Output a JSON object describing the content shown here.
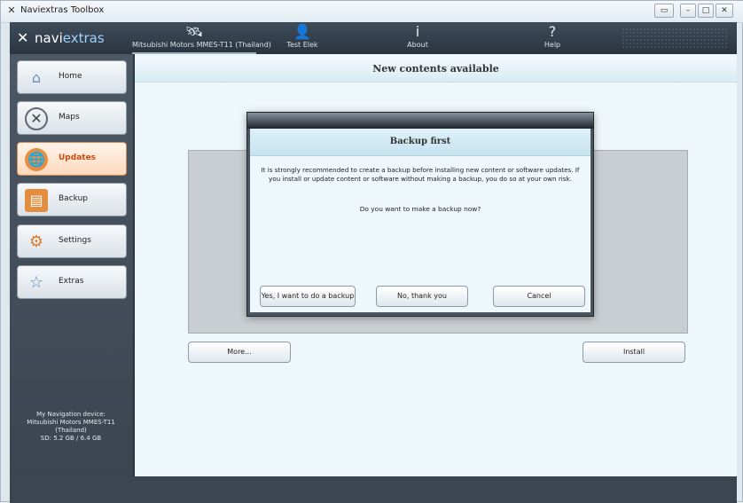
{
  "window": {
    "title": "Naviextras Toolbox",
    "app_icon": "naviextras-x-icon",
    "controls": [
      "window-extra-icon",
      "minimize-icon",
      "maximize-icon",
      "close-icon"
    ]
  },
  "brand": {
    "word1": "navi",
    "word2": "extras"
  },
  "topnav": {
    "tabs": [
      {
        "label": "Mitsubishi Motors MMES-T11 (Thailand)",
        "icon": "satellite-icon",
        "active": true
      },
      {
        "label": "Test Elek",
        "icon": "user-icon",
        "active": false
      },
      {
        "label": "About",
        "icon": "info-icon",
        "active": false
      },
      {
        "label": "Help",
        "icon": "question-icon",
        "active": false
      }
    ]
  },
  "sidebar": {
    "items": [
      {
        "label": "Home",
        "icon": "home-icon",
        "active": false
      },
      {
        "label": "Maps",
        "icon": "maps-icon",
        "active": false
      },
      {
        "label": "Updates",
        "icon": "updates-icon",
        "active": true
      },
      {
        "label": "Backup",
        "icon": "backup-icon",
        "active": false
      },
      {
        "label": "Settings",
        "icon": "settings-icon",
        "active": false
      },
      {
        "label": "Extras",
        "icon": "star-icon",
        "active": false
      }
    ],
    "device_info": [
      "My Navigation device:",
      "Mitsubishi Motors MMES-T11",
      "(Thailand)",
      "SD: 5.2 GB / 6.4 GB"
    ]
  },
  "main": {
    "title": "New contents available",
    "more_button": "More...",
    "install_button": "Install"
  },
  "dialog": {
    "title": "Backup first",
    "message": "It is strongly recommended to create a backup before installing new content or software updates. If you install or update content or software without making a backup, you do so at your own risk.",
    "question": "Do you want to make a backup now?",
    "yes_button": "Yes, I want to do a backup",
    "no_button": "No, thank you",
    "cancel_button": "Cancel"
  },
  "colors": {
    "accent_active": "#cc4a12",
    "topbar": "#2f3a45",
    "dialog_header": "#cfe7f2"
  }
}
